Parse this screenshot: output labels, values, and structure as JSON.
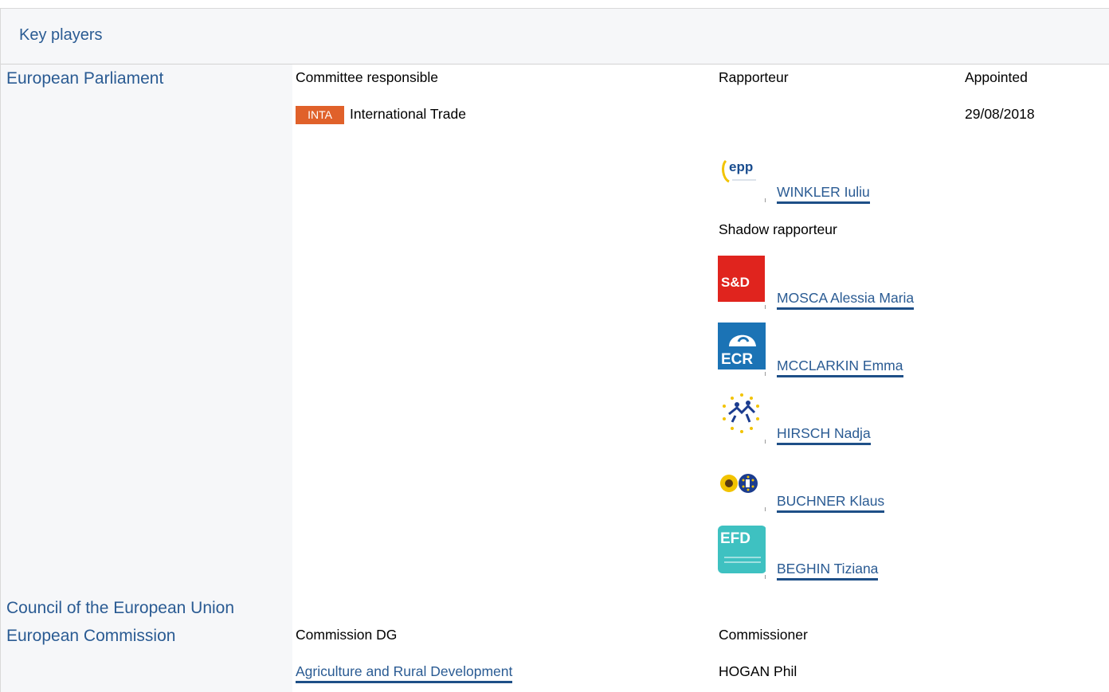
{
  "panel": {
    "title": "Key players"
  },
  "parliament": {
    "name": "European Parliament",
    "headers": {
      "committee": "Committee responsible",
      "rapporteur": "Rapporteur",
      "appointed": "Appointed"
    },
    "committee": {
      "abbr": "INTA",
      "name": "International Trade",
      "appointed": "29/08/2018"
    },
    "rapporteur": {
      "group_icon": "epp-logo",
      "name": "WINKLER Iuliu"
    },
    "shadow_label": "Shadow rapporteur",
    "shadows": [
      {
        "group_icon": "sd-logo",
        "logo_text": "S&D",
        "name": "MOSCA Alessia Maria"
      },
      {
        "group_icon": "ecr-logo",
        "logo_text": "ECR",
        "name": "MCCLARKIN Emma"
      },
      {
        "group_icon": "alde-logo",
        "name": "HIRSCH Nadja"
      },
      {
        "group_icon": "greens-efa-logo",
        "name": "BUCHNER Klaus"
      },
      {
        "group_icon": "efdd-logo",
        "logo_text": "EFD",
        "name": "BEGHIN Tiziana"
      }
    ],
    "epp_logo_text": "epp"
  },
  "council": {
    "name": "Council of the European Union"
  },
  "commission": {
    "name": "European Commission",
    "headers": {
      "dg": "Commission DG",
      "commissioner": "Commissioner"
    },
    "dg": "Agriculture and Rural Development",
    "commissioner": "HOGAN Phil"
  }
}
